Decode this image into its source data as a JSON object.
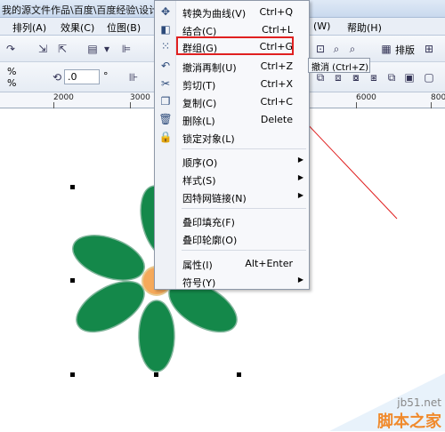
{
  "window": {
    "title": "我的源文件作品\\百度\\百度经验\\设计1"
  },
  "menubar": {
    "items": [
      "排列(A)",
      "效果(C)",
      "位图(B)",
      "(W)",
      "帮助(H)"
    ]
  },
  "toolbar": {
    "arrange_label": "排版",
    "angle_value": ".0",
    "angle_unit": "°",
    "percent_symbol": "%"
  },
  "ruler": {
    "labels": [
      "2000",
      "3000",
      "6000",
      "8000"
    ]
  },
  "context_menu": {
    "items": [
      {
        "label": "转换为曲线(V)",
        "shortcut": "Ctrl+Q",
        "icon": "convert-curve-icon"
      },
      {
        "label": "结合(C)",
        "shortcut": "Ctrl+L",
        "icon": "combine-icon"
      },
      {
        "label": "群组(G)",
        "shortcut": "Ctrl+G",
        "icon": "group-icon"
      },
      {
        "label": "撤消再制(U)",
        "shortcut": "Ctrl+Z",
        "icon": "undo-icon"
      },
      {
        "label": "剪切(T)",
        "shortcut": "Ctrl+X",
        "icon": "cut-icon"
      },
      {
        "label": "复制(C)",
        "shortcut": "Ctrl+C",
        "icon": "copy-icon"
      },
      {
        "label": "删除(L)",
        "shortcut": "Delete",
        "icon": "delete-icon"
      },
      {
        "label": "锁定对象(L)",
        "shortcut": "",
        "icon": "lock-icon"
      },
      {
        "label": "顺序(O)",
        "shortcut": "",
        "submenu": true
      },
      {
        "label": "样式(S)",
        "shortcut": "",
        "submenu": true
      },
      {
        "label": "因特网链接(N)",
        "shortcut": "",
        "submenu": true
      },
      {
        "label": "叠印填充(F)",
        "shortcut": ""
      },
      {
        "label": "叠印轮廓(O)",
        "shortcut": ""
      },
      {
        "label": "属性(I)",
        "shortcut": "Alt+Enter"
      },
      {
        "label": "符号(Y)",
        "shortcut": "",
        "submenu": true
      }
    ]
  },
  "tooltip": {
    "text": "撤消 (Ctrl+Z)"
  },
  "watermark": {
    "site": "jb51.net",
    "name": "脚本之家"
  },
  "colors": {
    "petal": "#14884a",
    "petal_edge": "#7fb59a",
    "center": "#f5a95a",
    "highlight": "#e02020",
    "arrow": "#e02020"
  }
}
